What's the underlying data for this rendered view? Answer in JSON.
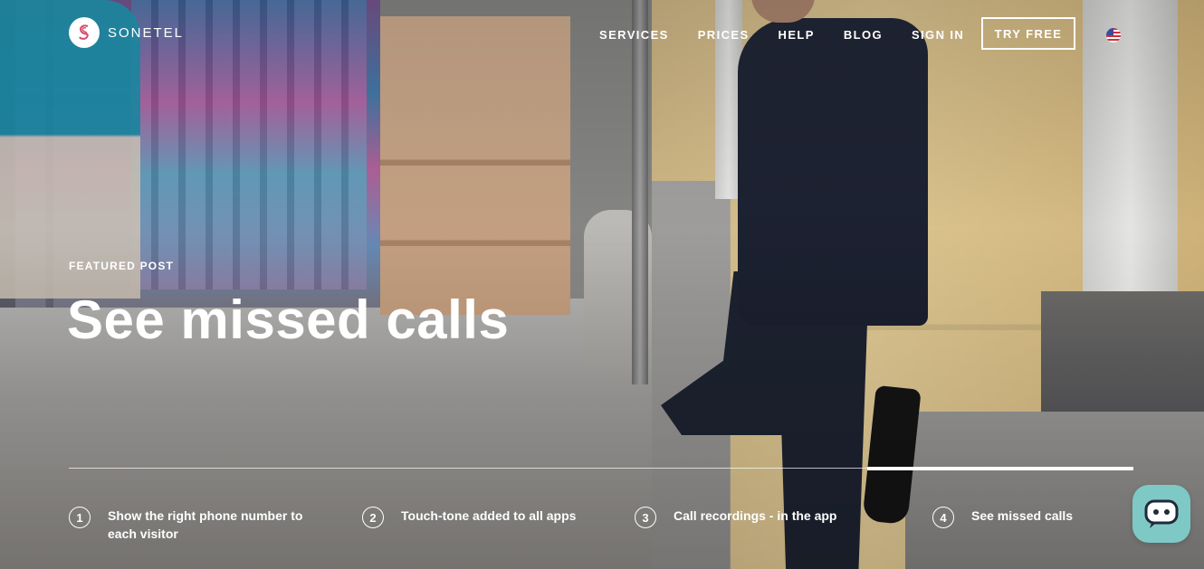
{
  "brand": {
    "name": "SONETEL",
    "logo_icon": "sonetel-logo-icon"
  },
  "nav": {
    "items": [
      "SERVICES",
      "PRICES",
      "HELP",
      "BLOG",
      "SIGN IN"
    ],
    "cta_label": "TRY FREE",
    "language_icon": "us-flag-icon"
  },
  "hero": {
    "eyebrow": "FEATURED POST",
    "title": "See missed calls"
  },
  "slider": {
    "active_index": 4,
    "tabs": [
      {
        "number": "1",
        "label": "Show the right phone number to each visitor"
      },
      {
        "number": "2",
        "label": "Touch-tone added to all apps"
      },
      {
        "number": "3",
        "label": "Call recordings - in the app"
      },
      {
        "number": "4",
        "label": "See missed calls"
      }
    ]
  },
  "chat": {
    "icon": "chat-bot-icon",
    "color": "#7ec9c5"
  }
}
